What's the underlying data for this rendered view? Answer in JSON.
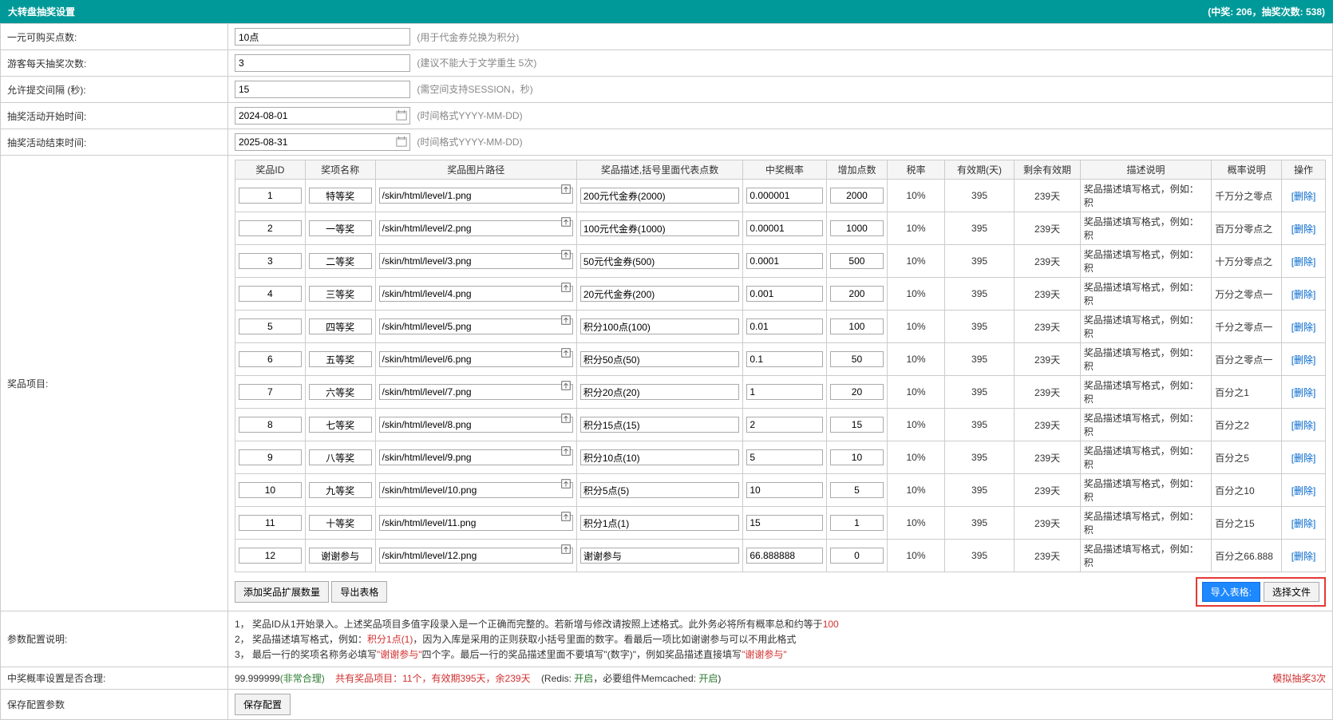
{
  "header": {
    "title": "大转盘抽奖设置",
    "stats": "(中奖: 206，抽奖次数: 538)"
  },
  "settings": {
    "points_label": "一元可购买点数:",
    "points_val": "10点",
    "points_hint": "(用于代金券兑换为积分)",
    "guest_label": "游客每天抽奖次数:",
    "guest_val": "3",
    "guest_hint": "(建议不能大于文学重生 5次)",
    "interval_label": "允许提交间隔 (秒):",
    "interval_val": "15",
    "interval_hint": "(需空间支持SESSION，秒)",
    "start_label": "抽奖活动开始时间:",
    "start_val": "2024-08-01",
    "start_hint": "(时间格式YYYY-MM-DD)",
    "end_label": "抽奖活动结束时间:",
    "end_val": "2025-08-31",
    "end_hint": "(时间格式YYYY-MM-DD)",
    "prizes_label": "奖品项目:"
  },
  "columns": {
    "id": "奖品ID",
    "name": "奖项名称",
    "img": "奖品图片路径",
    "desc": "奖品描述,括号里面代表点数",
    "prob": "中奖概率",
    "pts": "增加点数",
    "tax": "税率",
    "valid": "有效期(天)",
    "remain": "剩余有效期",
    "ddesc": "描述说明",
    "pdesc": "概率说明",
    "op": "操作"
  },
  "rows": [
    {
      "id": "1",
      "name": "特等奖",
      "img": "/skin/html/level/1.png",
      "desc": "200元代金券(2000)",
      "prob": "0.000001",
      "pts": "2000",
      "tax": "10%",
      "valid": "395",
      "remain": "239天",
      "ddesc": "奖品描述填写格式，例如：积",
      "pdesc": "千万分之零点"
    },
    {
      "id": "2",
      "name": "一等奖",
      "img": "/skin/html/level/2.png",
      "desc": "100元代金券(1000)",
      "prob": "0.00001",
      "pts": "1000",
      "tax": "10%",
      "valid": "395",
      "remain": "239天",
      "ddesc": "奖品描述填写格式，例如：积",
      "pdesc": "百万分零点之"
    },
    {
      "id": "3",
      "name": "二等奖",
      "img": "/skin/html/level/3.png",
      "desc": "50元代金券(500)",
      "prob": "0.0001",
      "pts": "500",
      "tax": "10%",
      "valid": "395",
      "remain": "239天",
      "ddesc": "奖品描述填写格式，例如：积",
      "pdesc": "十万分零点之"
    },
    {
      "id": "4",
      "name": "三等奖",
      "img": "/skin/html/level/4.png",
      "desc": "20元代金券(200)",
      "prob": "0.001",
      "pts": "200",
      "tax": "10%",
      "valid": "395",
      "remain": "239天",
      "ddesc": "奖品描述填写格式，例如：积",
      "pdesc": "万分之零点一"
    },
    {
      "id": "5",
      "name": "四等奖",
      "img": "/skin/html/level/5.png",
      "desc": "积分100点(100)",
      "prob": "0.01",
      "pts": "100",
      "tax": "10%",
      "valid": "395",
      "remain": "239天",
      "ddesc": "奖品描述填写格式，例如：积",
      "pdesc": "千分之零点一"
    },
    {
      "id": "6",
      "name": "五等奖",
      "img": "/skin/html/level/6.png",
      "desc": "积分50点(50)",
      "prob": "0.1",
      "pts": "50",
      "tax": "10%",
      "valid": "395",
      "remain": "239天",
      "ddesc": "奖品描述填写格式，例如：积",
      "pdesc": "百分之零点一"
    },
    {
      "id": "7",
      "name": "六等奖",
      "img": "/skin/html/level/7.png",
      "desc": "积分20点(20)",
      "prob": "1",
      "pts": "20",
      "tax": "10%",
      "valid": "395",
      "remain": "239天",
      "ddesc": "奖品描述填写格式，例如：积",
      "pdesc": "百分之1"
    },
    {
      "id": "8",
      "name": "七等奖",
      "img": "/skin/html/level/8.png",
      "desc": "积分15点(15)",
      "prob": "2",
      "pts": "15",
      "tax": "10%",
      "valid": "395",
      "remain": "239天",
      "ddesc": "奖品描述填写格式，例如：积",
      "pdesc": "百分之2"
    },
    {
      "id": "9",
      "name": "八等奖",
      "img": "/skin/html/level/9.png",
      "desc": "积分10点(10)",
      "prob": "5",
      "pts": "10",
      "tax": "10%",
      "valid": "395",
      "remain": "239天",
      "ddesc": "奖品描述填写格式，例如：积",
      "pdesc": "百分之5"
    },
    {
      "id": "10",
      "name": "九等奖",
      "img": "/skin/html/level/10.png",
      "desc": "积分5点(5)",
      "prob": "10",
      "pts": "5",
      "tax": "10%",
      "valid": "395",
      "remain": "239天",
      "ddesc": "奖品描述填写格式，例如：积",
      "pdesc": "百分之10"
    },
    {
      "id": "11",
      "name": "十等奖",
      "img": "/skin/html/level/11.png",
      "desc": "积分1点(1)",
      "prob": "15",
      "pts": "1",
      "tax": "10%",
      "valid": "395",
      "remain": "239天",
      "ddesc": "奖品描述填写格式，例如：积",
      "pdesc": "百分之15"
    },
    {
      "id": "12",
      "name": "谢谢参与",
      "img": "/skin/html/level/12.png",
      "desc": "谢谢参与",
      "prob": "66.888888",
      "pts": "0",
      "tax": "10%",
      "valid": "395",
      "remain": "239天",
      "ddesc": "奖品描述填写格式，例如：积",
      "pdesc": "百分之66.888"
    }
  ],
  "del_label": "[删除]",
  "actions": {
    "add": "添加奖品扩展数量",
    "export": "导出表格",
    "import_label": "导入表格:",
    "choose": "选择文件"
  },
  "desc_label": "参数配置说明:",
  "desc": {
    "l1a": "1，   奖品ID从1开始录入。上述奖品项目多值字段录入是一个正确而完整的。若新增与修改请按照上述格式。此外务必将所有概率总和约等于",
    "l1b": "100",
    "l2a": "2，   奖品描述填写格式，例如：",
    "l2b": "积分1点(1)",
    "l2c": "，因为入库是采用的正则获取小括号里面的数字。看最后一项比如谢谢参与可以不用此格式",
    "l3a": "3，   最后一行的奖项名称务必填写",
    "l3b": "\"谢谢参与\"",
    "l3c": "四个字。最后一行的奖品描述里面不要填写\"(数字)\"，例如奖品描述直接填写",
    "l3d": "\"谢谢参与\""
  },
  "valid": {
    "label": "中奖概率设置是否合理:",
    "v1": "99.999999",
    "v2": "(非常合理)",
    "v3": "共有奖品项目：11个，有效期395天，余239天",
    "v4": "(Redis:  ",
    "v5": "开启",
    "v6": "，必要组件Memcached:  ",
    "v7": "开启",
    "v8": ")",
    "sim": "模拟抽奖3次"
  },
  "save": {
    "label": "保存配置参数",
    "btn": "保存配置"
  }
}
